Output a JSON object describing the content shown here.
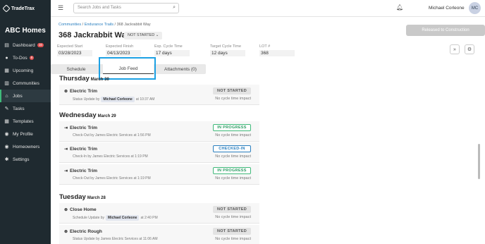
{
  "app": {
    "brand": "TradeTrax",
    "company": "ABC Homes"
  },
  "sidebar": {
    "items": [
      {
        "label": "Dashboard",
        "icon": "dashboard-icon",
        "glyph": "▤",
        "badge": "16"
      },
      {
        "label": "To-Dos",
        "icon": "todo-icon",
        "glyph": "●",
        "badge": "8"
      },
      {
        "label": "Upcoming",
        "icon": "calendar-icon",
        "glyph": "▦",
        "badge": ""
      },
      {
        "label": "Communities",
        "icon": "community-icon",
        "glyph": "▥",
        "badge": ""
      },
      {
        "label": "Jobs",
        "icon": "home-icon",
        "glyph": "⌂",
        "badge": ""
      },
      {
        "label": "Tasks",
        "icon": "wrench-icon",
        "glyph": "✎",
        "badge": ""
      },
      {
        "label": "Templates",
        "icon": "template-icon",
        "glyph": "▦",
        "badge": ""
      },
      {
        "label": "My Profile",
        "icon": "profile-icon",
        "glyph": "◉",
        "badge": ""
      },
      {
        "label": "Homeowners",
        "icon": "homeowner-icon",
        "glyph": "◉",
        "badge": ""
      },
      {
        "label": "Settings",
        "icon": "gear-icon",
        "glyph": "✱",
        "badge": ""
      }
    ]
  },
  "topbar": {
    "search_placeholder": "Search Jobs and Tasks",
    "user": "Michael Corleone",
    "initials": "MC"
  },
  "job": {
    "breadcrumb": {
      "l1": "Communities",
      "l2": "Endurance Trails",
      "l3": "368 Jackrabbit Way"
    },
    "title": "368 Jackrabbit Way",
    "status": "NOT STARTED ⌄",
    "release": "Released to Construction",
    "meta": [
      {
        "label": "Expected Start",
        "value": "03/28/2023"
      },
      {
        "label": "Expected Finish",
        "value": "04/13/2023"
      },
      {
        "label": "Exp. Cycle Time",
        "value": "17 days"
      },
      {
        "label": "Target Cycle Time",
        "value": "12 days"
      },
      {
        "label": "LOT #",
        "value": "368"
      }
    ]
  },
  "tabs": [
    "Schedule",
    "Job Feed",
    "Attachments (0)"
  ],
  "feed": {
    "days": [
      {
        "name": "Thursday",
        "date": "March 30"
      },
      {
        "name": "Wednesday",
        "date": "March 29"
      },
      {
        "name": "Tuesday",
        "date": "March 28"
      }
    ],
    "items": [
      {
        "title": "Electric Trim",
        "pre": "Status Update by",
        "who": "Michael Corleone",
        "post": "at 10:37 AM",
        "status": "NOT STARTED",
        "impact": "No cycle time impact"
      },
      {
        "title": "Electric Trim",
        "pre": "Check-Out by",
        "who": "James Electric Services",
        "post": "at 1:56 PM",
        "status": "IN PROGRESS",
        "impact": "No cycle time impact"
      },
      {
        "title": "Electric Trim",
        "pre": "Check-In by",
        "who": "James Electric Services",
        "post": "at 1:19 PM",
        "status": "CHECKED-IN",
        "impact": "No cycle time impact"
      },
      {
        "title": "Electric Trim",
        "pre": "Check-Out by",
        "who": "James Electric Services",
        "post": "at 1:19 PM",
        "status": "IN PROGRESS",
        "impact": "No cycle time impact"
      },
      {
        "title": "Close Home",
        "pre": "Schedule Update by",
        "who": "Michael Corleone",
        "post": "at 2:40 PM",
        "status": "NOT STARTED",
        "impact": "No cycle time impact"
      },
      {
        "title": "Electric Rough",
        "pre": "Status Update by",
        "who": "James Electric Services",
        "post": "at 11:06 AM",
        "status": "NOT STARTED",
        "impact": "No cycle time impact"
      }
    ]
  }
}
